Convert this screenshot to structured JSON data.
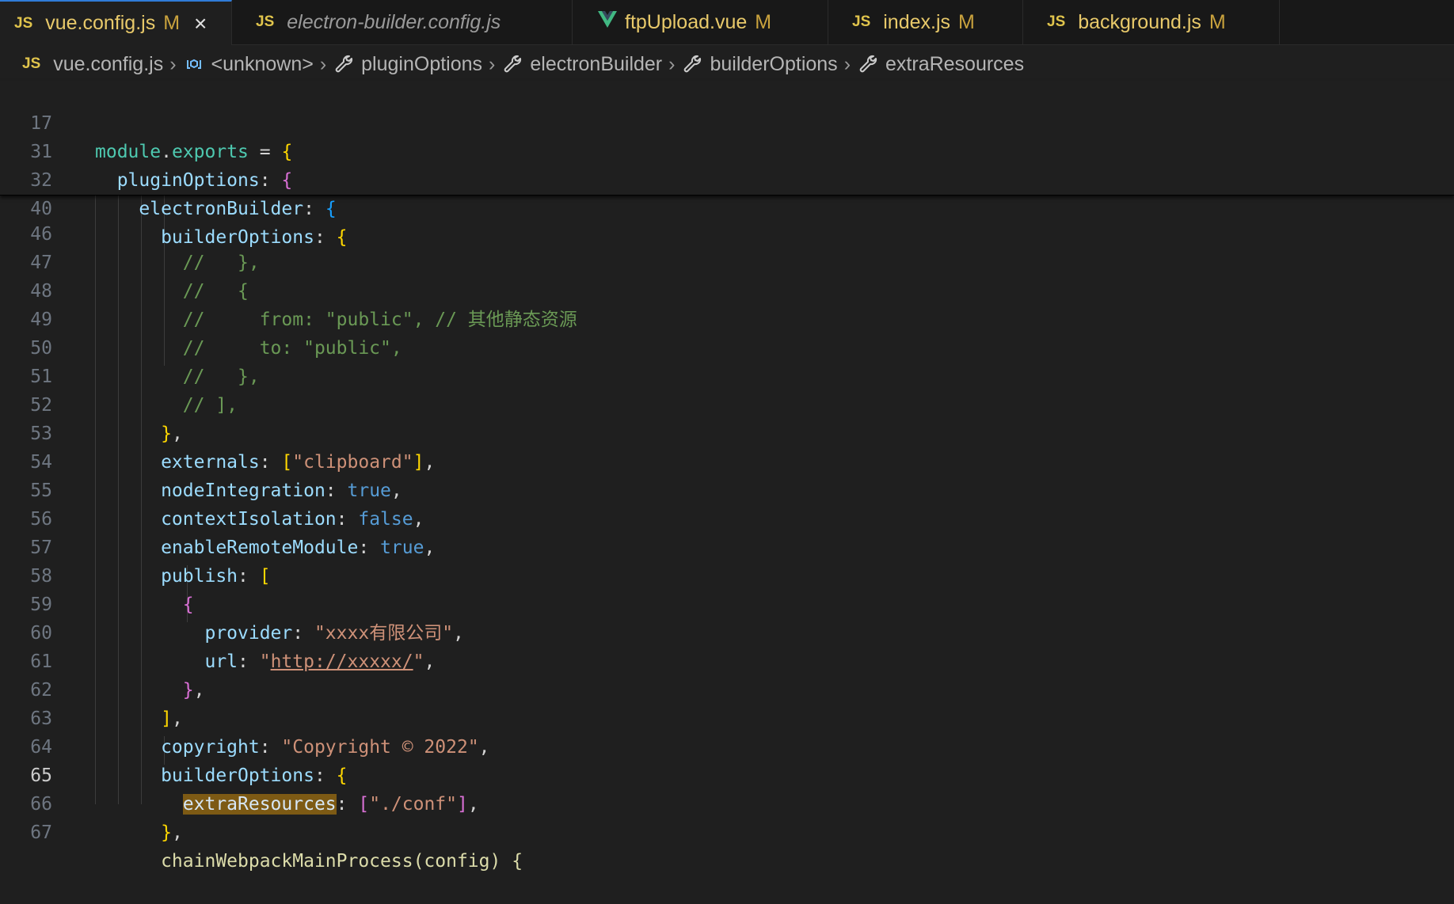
{
  "tabs": [
    {
      "icon": "JS",
      "label": "vue.config.js",
      "modified": "M",
      "close": "×"
    },
    {
      "icon": "JS",
      "label": "electron-builder.config.js"
    },
    {
      "icon": "V",
      "label": "ftpUpload.vue",
      "modified": "M"
    },
    {
      "icon": "JS",
      "label": "index.js",
      "modified": "M"
    },
    {
      "icon": "JS",
      "label": "background.js",
      "modified": "M"
    }
  ],
  "breadcrumb": {
    "file_icon": "JS",
    "items": [
      "vue.config.js",
      "<unknown>",
      "pluginOptions",
      "electronBuilder",
      "builderOptions",
      "extraResources"
    ]
  },
  "editor": {
    "sticky": [
      {
        "n": "17",
        "t": "module.exports = {"
      },
      {
        "n": "31",
        "t": "  pluginOptions: {"
      },
      {
        "n": "32",
        "t": "    electronBuilder: {"
      },
      {
        "n": "40",
        "t": "      builderOptions: {"
      }
    ],
    "lines": [
      {
        "n": "46",
        "t": "        //   },"
      },
      {
        "n": "47",
        "t": "        //   {"
      },
      {
        "n": "48",
        "t": "        //     from: \"public\", // 其他静态资源"
      },
      {
        "n": "49",
        "t": "        //     to: \"public\","
      },
      {
        "n": "50",
        "t": "        //   },"
      },
      {
        "n": "51",
        "t": "        // ],"
      },
      {
        "n": "52",
        "t": "      },"
      },
      {
        "n": "53",
        "t": "      externals: [\"clipboard\"],"
      },
      {
        "n": "54",
        "t": "      nodeIntegration: true,"
      },
      {
        "n": "55",
        "t": "      contextIsolation: false,"
      },
      {
        "n": "56",
        "t": "      enableRemoteModule: true,"
      },
      {
        "n": "57",
        "t": "      publish: ["
      },
      {
        "n": "58",
        "t": "        {"
      },
      {
        "n": "59",
        "t": "          provider: \"xxxx有限公司\","
      },
      {
        "n": "60",
        "t": "          url: \"http://xxxxx/\","
      },
      {
        "n": "61",
        "t": "        },"
      },
      {
        "n": "62",
        "t": "      ],"
      },
      {
        "n": "63",
        "t": "      copyright: \"Copyright © 2022\","
      },
      {
        "n": "64",
        "t": "      builderOptions: {"
      },
      {
        "n": "65",
        "t": "        extraResources: [\"./conf\"],"
      },
      {
        "n": "66",
        "t": "      },"
      },
      {
        "n": "67",
        "t": "      chainWebpackMainProcess(config) {"
      }
    ],
    "current_line": "65"
  },
  "colors": {
    "accent": "#2f7bd8",
    "js_icon": "#e0c44c",
    "vue_icon": "#41b883",
    "modified": "#c9a23d",
    "highlight": "#7d5a14"
  }
}
